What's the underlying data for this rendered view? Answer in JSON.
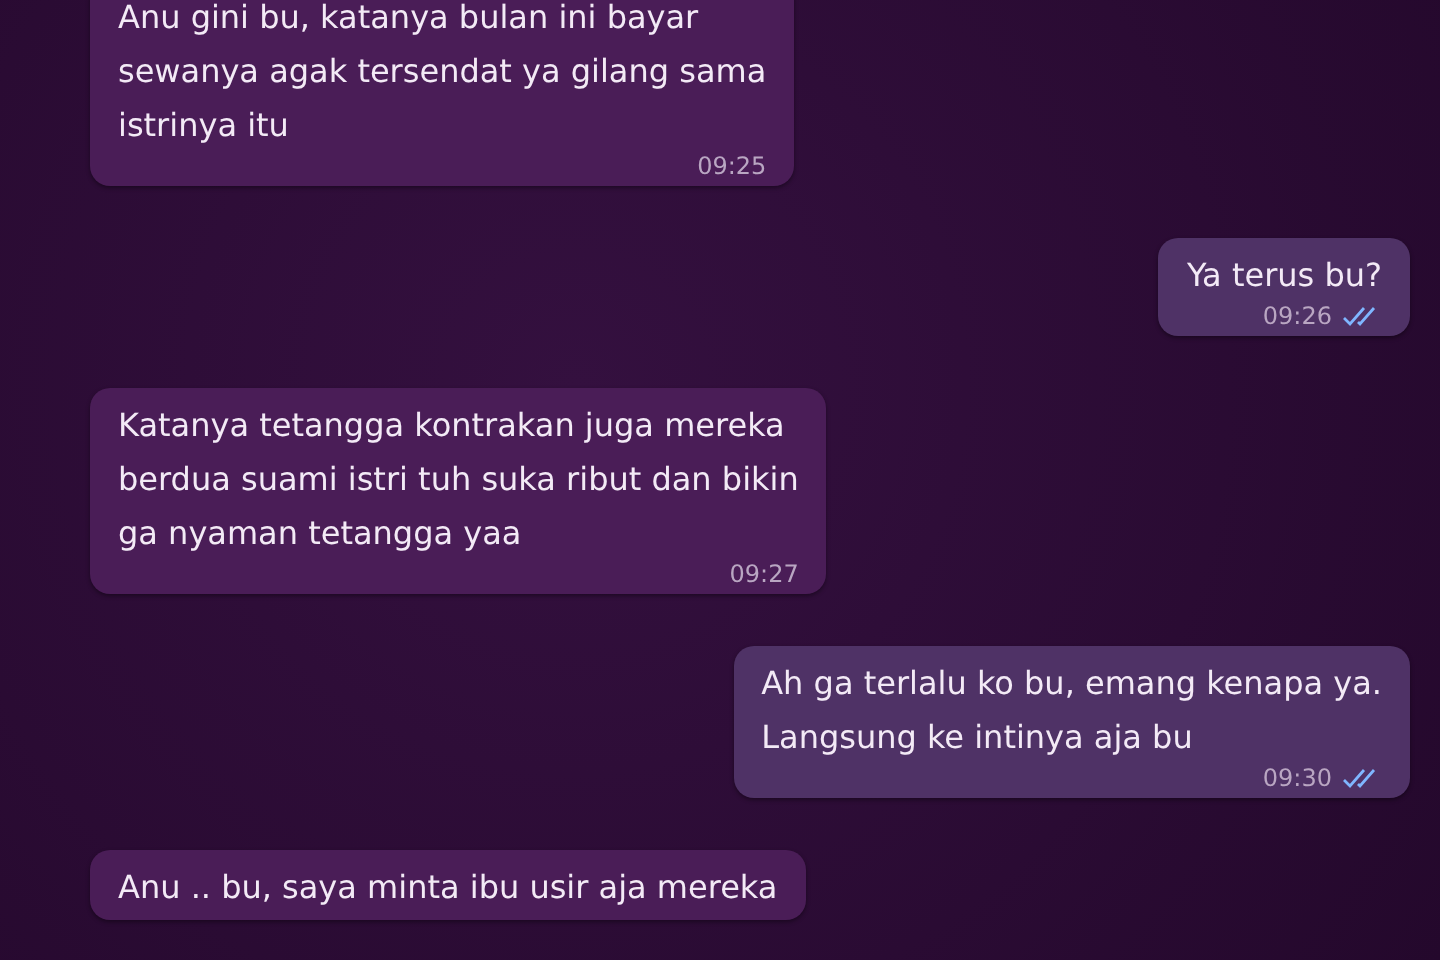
{
  "messages": [
    {
      "kind": "incoming",
      "text": "Anu gini bu, katanya bulan ini bayar\nsewanya agak tersendat ya gilang sama\nistrinya itu",
      "time": "09:25"
    },
    {
      "kind": "outgoing",
      "text": "Ya terus bu?",
      "time": "09:26",
      "read": true
    },
    {
      "kind": "incoming",
      "text": "Katanya tetangga kontrakan juga mereka\nberdua suami istri tuh suka ribut dan bikin\nga nyaman tetangga yaa",
      "time": "09:27"
    },
    {
      "kind": "outgoing",
      "text": "Ah ga terlalu ko bu, emang kenapa ya.\nLangsung ke intinya aja bu",
      "time": "09:30",
      "read": true
    },
    {
      "kind": "incoming",
      "text": "Anu .. bu, saya minta ibu usir aja mereka"
    }
  ]
}
